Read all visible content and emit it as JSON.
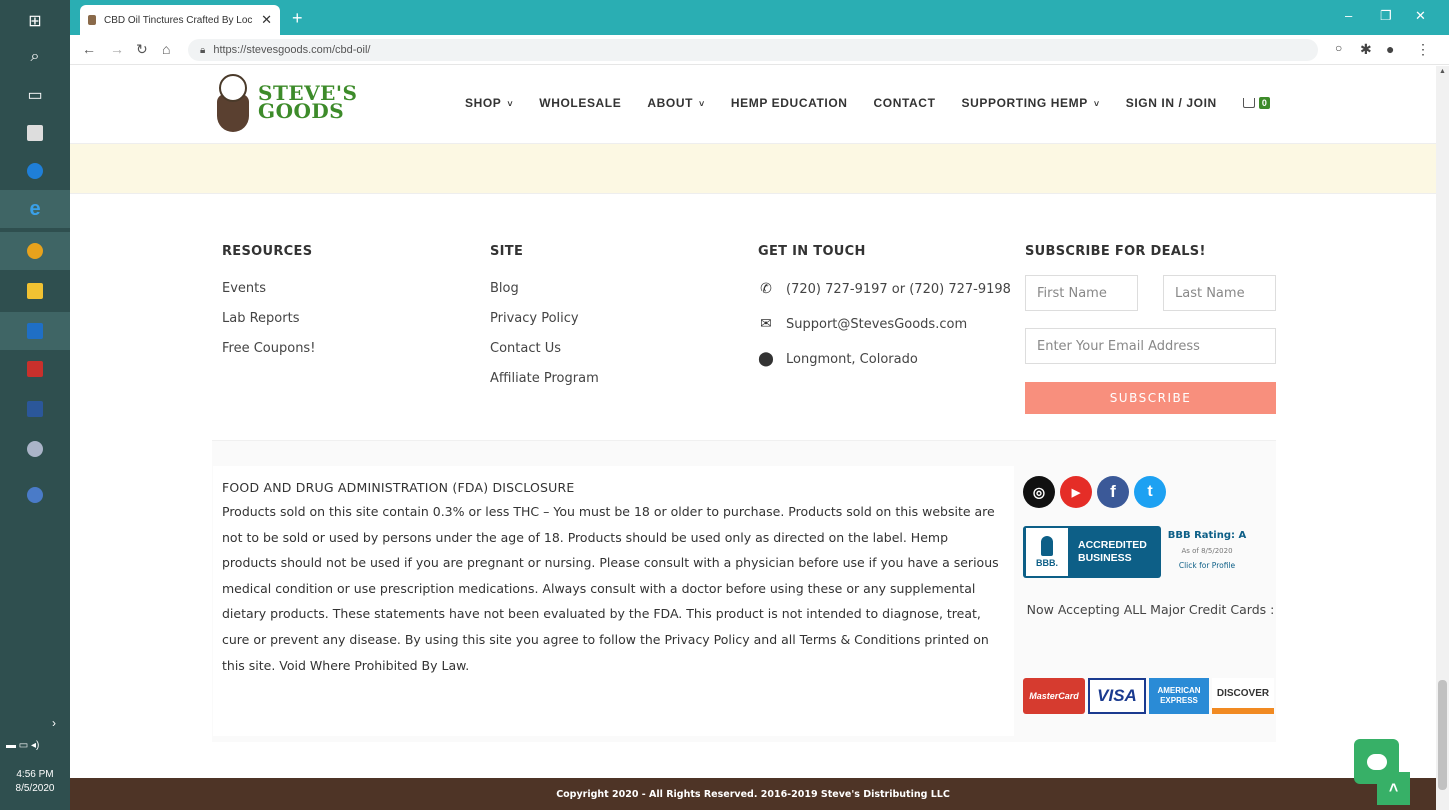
{
  "taskbar": {
    "icons": [
      "start-icon",
      "search-icon",
      "task-view-icon",
      "calculator-icon",
      "edge-icon",
      "internet-explorer-icon",
      "chrome-icon",
      "file-explorer-icon",
      "outlook-icon",
      "acrobat-icon",
      "word-icon",
      "app-icon",
      "app-icon-2"
    ],
    "time": "4:56 PM",
    "date": "8/5/2020"
  },
  "browser": {
    "tab_title": "CBD Oil Tinctures Crafted By Loc",
    "url": "https://stevesgoods.com/cbd-oil/",
    "accent": "#2aaeb3"
  },
  "header": {
    "logo_line1": "STEVE'S",
    "logo_line2": "GOODS",
    "nav": [
      {
        "label": "SHOP",
        "caret": "˅"
      },
      {
        "label": "WHOLESALE",
        "caret": ""
      },
      {
        "label": "ABOUT",
        "caret": "˅"
      },
      {
        "label": "HEMP EDUCATION",
        "caret": ""
      },
      {
        "label": "CONTACT",
        "caret": ""
      },
      {
        "label": "SUPPORTING HEMP",
        "caret": "˅"
      },
      {
        "label": "SIGN IN / JOIN",
        "caret": ""
      }
    ],
    "cart_count": "0"
  },
  "footer": {
    "resources": {
      "heading": "RESOURCES",
      "links": [
        "Events",
        "Lab Reports",
        "Free Coupons!"
      ]
    },
    "site": {
      "heading": "SITE",
      "links": [
        "Blog",
        "Privacy Policy",
        "Contact Us",
        "Affiliate Program"
      ]
    },
    "contact": {
      "heading": "GET IN TOUCH",
      "phone": "(720) 727-9197 or (720) 727-9198",
      "email": "Support@StevesGoods.com",
      "location": "Longmont, Colorado"
    },
    "subscribe": {
      "heading": "SUBSCRIBE FOR DEALS!",
      "first_name_placeholder": "First Name",
      "last_name_placeholder": "Last Name",
      "email_placeholder": "Enter Your Email Address",
      "button": "SUBSCRIBE"
    },
    "fda": {
      "heading": "FOOD AND DRUG ADMINISTRATION (FDA) DISCLOSURE",
      "text": "Products sold on this site contain 0.3% or less THC – You must be 18 or older to purchase. Products sold on this website are not to be sold or used by persons under the age of 18. Products should be used only as directed on the label. Hemp products should not be used if you are pregnant or nursing. Please consult with a physician before use if you have a serious medical condition or use prescription medications. Always consult with a doctor before using these or any supplemental dietary products. These statements have not been evaluated by the FDA. This product is not intended to diagnose, treat, cure or prevent any disease. By using this site you agree to follow the Privacy Policy and all Terms & Conditions printed on this site. Void Where Prohibited By Law."
    },
    "social": [
      {
        "name": "instagram-icon",
        "glyph": "◎",
        "color": "#111111"
      },
      {
        "name": "youtube-icon",
        "glyph": "▶",
        "color": "#e52d27"
      },
      {
        "name": "facebook-icon",
        "glyph": "f",
        "color": "#3b5998"
      },
      {
        "name": "twitter-icon",
        "glyph": "t",
        "color": "#1da1f2"
      }
    ],
    "bbb": {
      "seal": "BBB.",
      "badge_line1": "ACCREDITED",
      "badge_line2": "BUSINESS",
      "rating": "BBB Rating: A",
      "as_of": "As of 8/5/2020",
      "profile": "Click for Profile"
    },
    "accepting": "Now Accepting ALL Major Credit Cards :",
    "cards": {
      "mastercard": "MasterCard",
      "visa": "VISA",
      "amex_line1": "AMERICAN",
      "amex_line2": "EXPRESS",
      "discover": "DISCOVER"
    },
    "copyright": "Copyright 2020 - All Rights Reserved. 2016-2019 Steve's Distributing LLC"
  },
  "colors": {
    "brand_green": "#3d8b2a",
    "footer_brown": "#4e3426",
    "subscribe": "#f88f7d",
    "cream": "#fcf8e3",
    "chat_green": "#37b067"
  }
}
